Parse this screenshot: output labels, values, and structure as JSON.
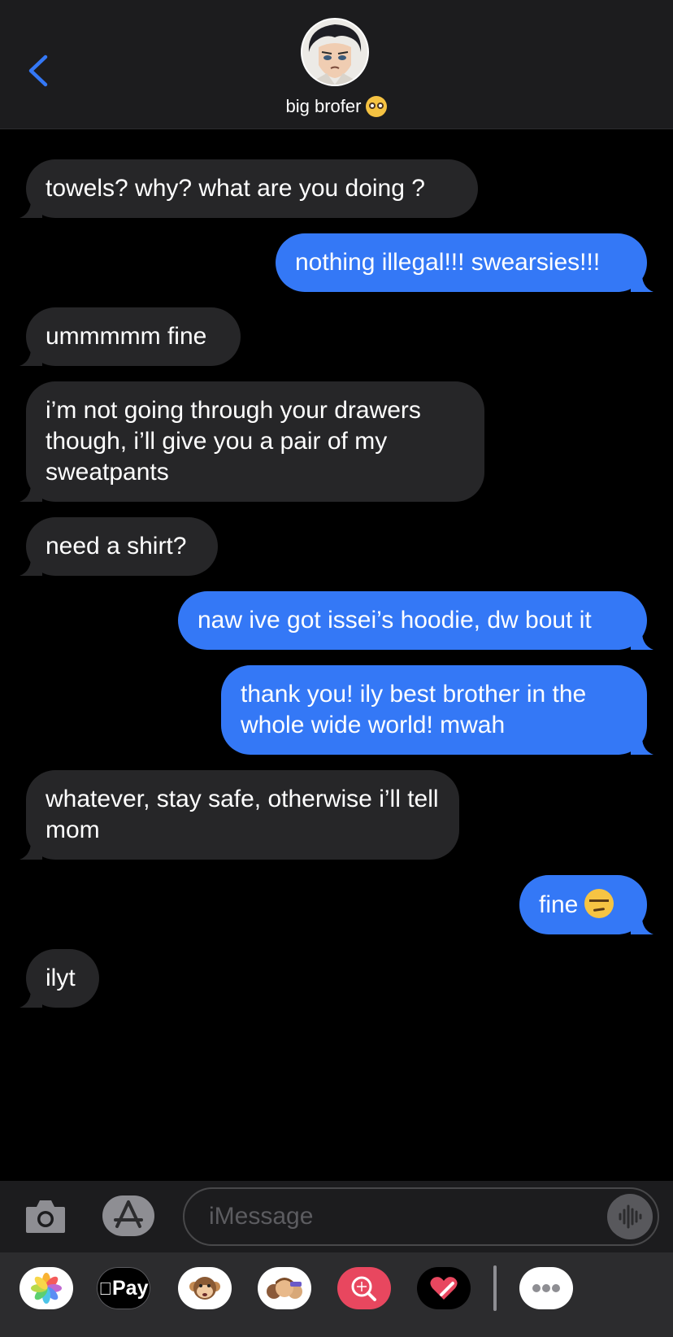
{
  "header": {
    "contact_name": "big brofer",
    "back_icon": "chevron-left-icon",
    "accent": "#3478f6",
    "name_emoji": "pleading-face-emoji"
  },
  "messages": [
    {
      "direction": "incoming",
      "text": "towels? why? what are you doing ?"
    },
    {
      "direction": "outgoing",
      "text": "nothing illegal!!! swearsies!!!"
    },
    {
      "direction": "incoming",
      "text": "ummmmm fine"
    },
    {
      "direction": "incoming",
      "text": "i’m not going through your drawers though, i’ll give you a pair of my sweatpants"
    },
    {
      "direction": "incoming",
      "text": "need a shirt?"
    },
    {
      "direction": "outgoing",
      "text": "naw ive got issei’s hoodie, dw bout it"
    },
    {
      "direction": "outgoing",
      "text": "thank you! ily best brother in the whole wide world! mwah"
    },
    {
      "direction": "incoming",
      "text": "whatever, stay safe, otherwise i’ll tell mom"
    },
    {
      "direction": "outgoing",
      "text": "fine",
      "emoji": "unamused-face-emoji"
    },
    {
      "direction": "incoming",
      "text": "ilyt"
    }
  ],
  "colors": {
    "incoming_bubble": "#262628",
    "outgoing_bubble": "#3478f6",
    "background": "#000000"
  },
  "input": {
    "placeholder": "iMessage",
    "camera_icon": "camera-icon",
    "apps_icon": "app-store-icon",
    "audio_icon": "audio-waveform-icon"
  },
  "app_drawer": {
    "apps": [
      "photos-icon",
      "apple-pay-icon",
      "animoji-icon",
      "memoji-icon",
      "image-search-icon",
      "digital-touch-icon",
      "more-icon"
    ],
    "apple_pay_label": "Pay"
  }
}
